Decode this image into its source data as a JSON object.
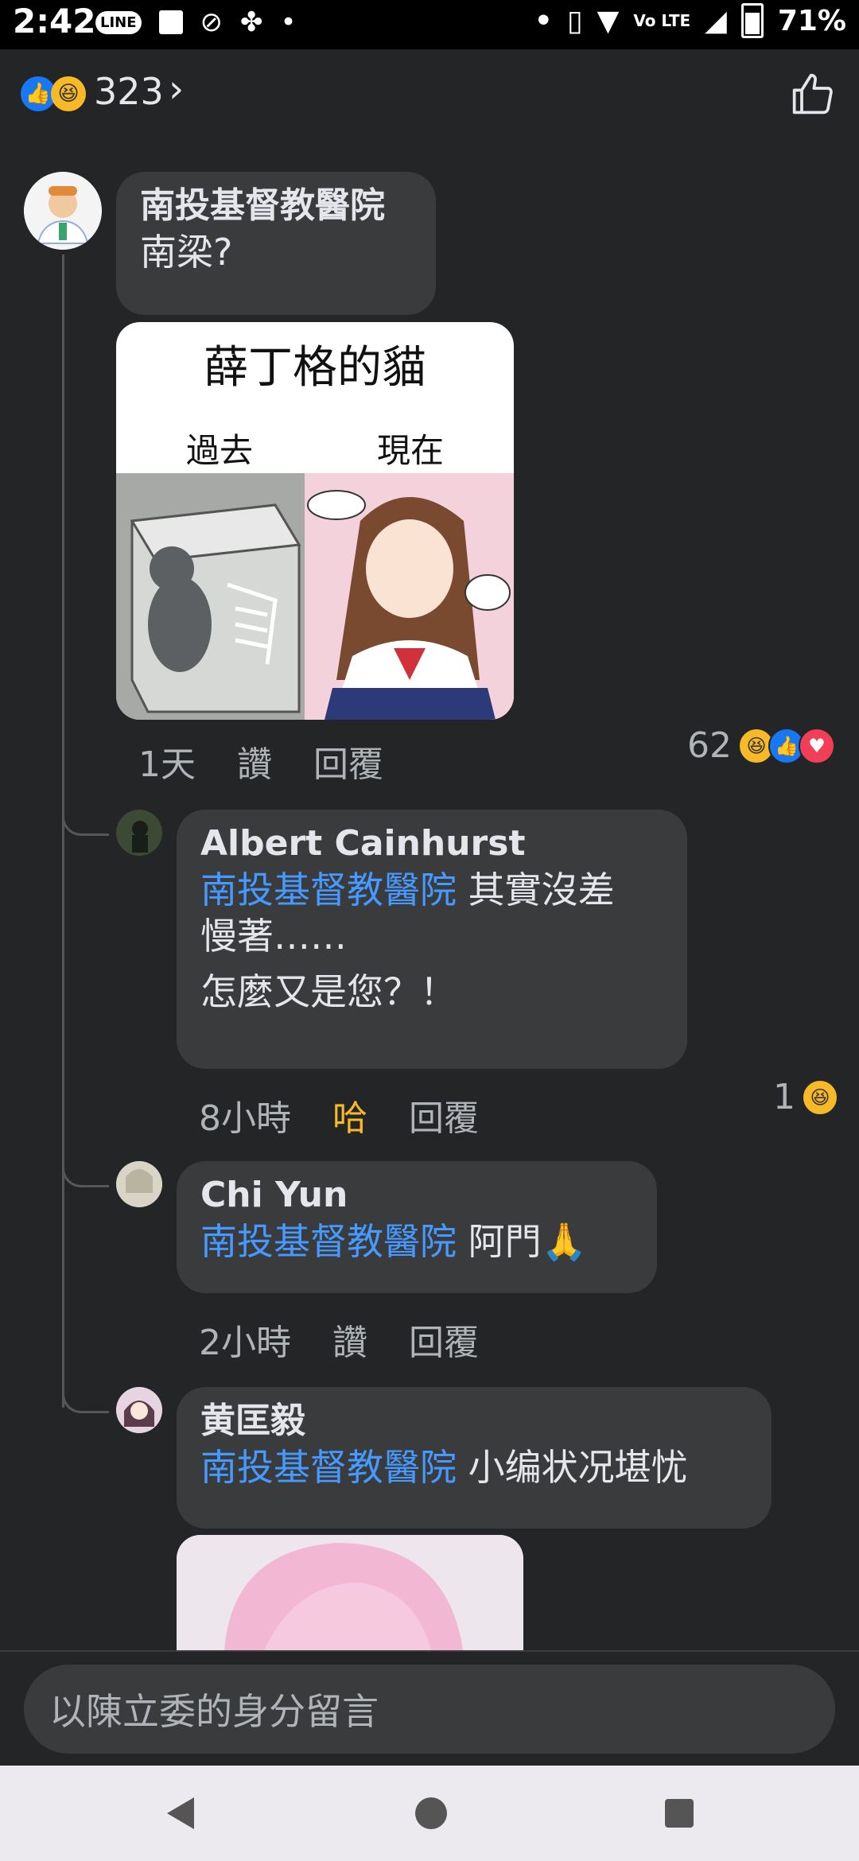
{
  "status_bar": {
    "time": "2:42",
    "battery": "71%",
    "line_label": "LINE",
    "net_label": "Vo LTE"
  },
  "reactions": {
    "count": "323",
    "icons": [
      "like",
      "haha"
    ]
  },
  "post": {
    "author": "南投基督教醫院",
    "text": "南梁?",
    "meme": {
      "title": "薛丁格的貓",
      "left_label": "過去",
      "right_label": "現在"
    },
    "time": "1天",
    "like_label": "讚",
    "reply_label": "回覆",
    "reaction_count": "62"
  },
  "replies": [
    {
      "author": "Albert Cainhurst",
      "mention": "南投基督教醫院",
      "text_line1": " 其實沒差",
      "text_line2": "慢著……",
      "text_line3": "怎麼又是您？！",
      "time": "8小時",
      "action_label": "哈",
      "reply_label": "回覆",
      "reaction_count": "1"
    },
    {
      "author": "Chi Yun",
      "mention": "南投基督教醫院",
      "text": " 阿門🙏",
      "time": "2小時",
      "action_label": "讚",
      "reply_label": "回覆"
    },
    {
      "author": "黄匡毅",
      "mention": "南投基督教醫院",
      "text": " 小编状况堪忧"
    }
  ],
  "composer": {
    "placeholder": "以陳立委的身分留言"
  },
  "colors": {
    "background": "#242526",
    "bubble": "#3a3b3c",
    "mention": "#4599ff",
    "haha": "#f7b928",
    "like": "#1877f2",
    "love": "#f33e58"
  }
}
